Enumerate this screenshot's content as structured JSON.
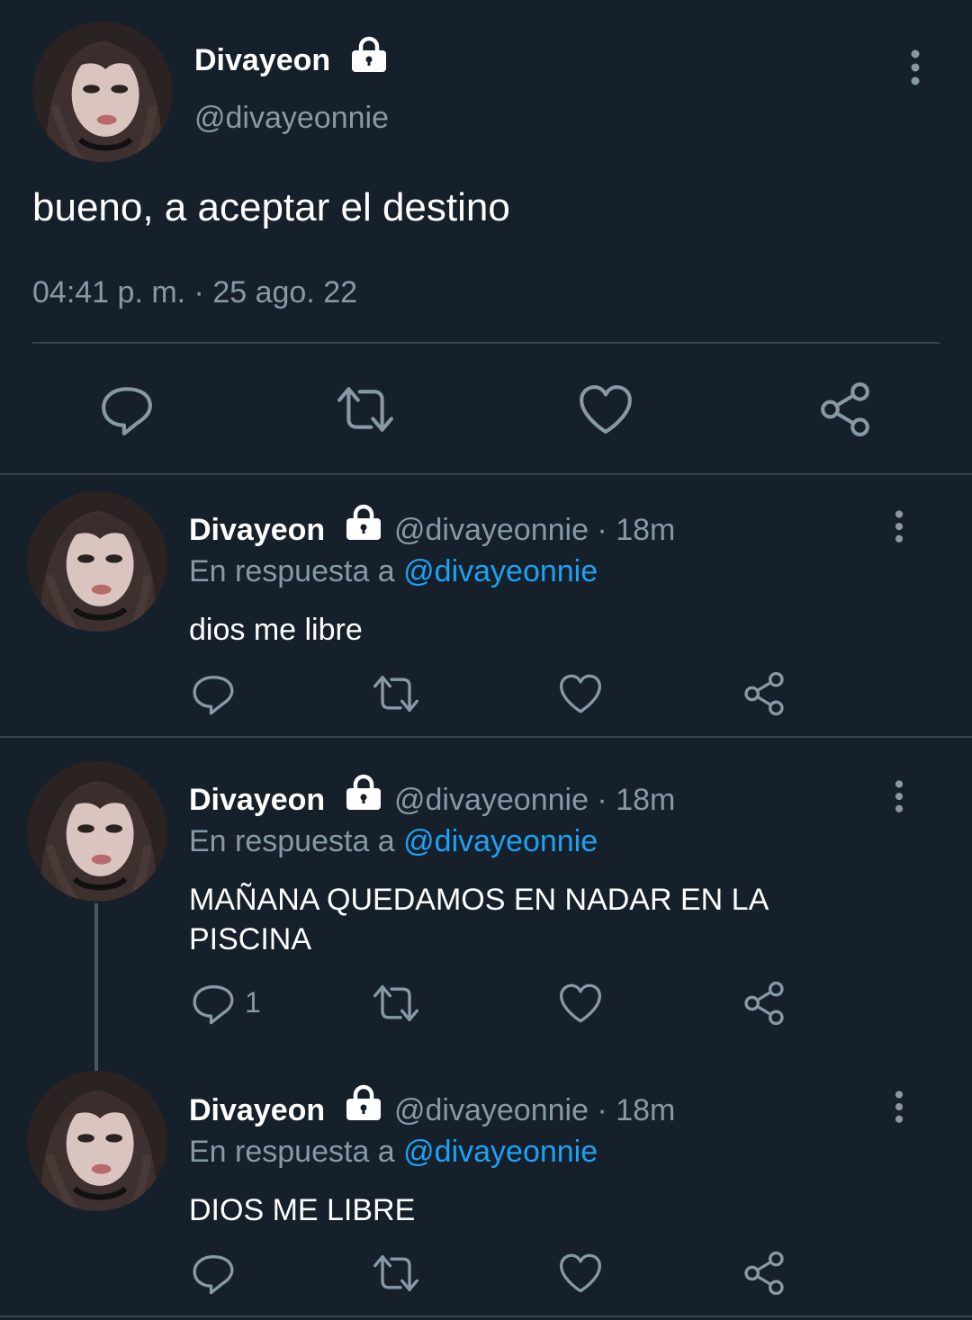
{
  "main_tweet": {
    "name": "Divayeon",
    "handle": "@divayeonnie",
    "text": "bueno, a aceptar el destino",
    "timestamp": "04:41 p. m. · 25 ago. 22",
    "icons": [
      "lock-icon",
      "more-vertical-icon",
      "reply-icon",
      "retweet-icon",
      "like-icon",
      "share-icon"
    ]
  },
  "replies": [
    {
      "name": "Divayeon",
      "handle_time": "@divayeonnie · 18m",
      "reply_prefix": "En respuesta a ",
      "reply_to": "@divayeonnie",
      "text": "dios me libre",
      "reply_count": ""
    },
    {
      "name": "Divayeon",
      "handle_time": "@divayeonnie · 18m",
      "reply_prefix": "En respuesta a ",
      "reply_to": "@divayeonnie",
      "text": "MAÑANA QUEDAMOS EN NADAR EN LA PISCINA",
      "reply_count": "1"
    },
    {
      "name": "Divayeon",
      "handle_time": "@divayeonnie · 18m",
      "reply_prefix": "En respuesta a ",
      "reply_to": "@divayeonnie",
      "text": "DIOS ME LIBRE",
      "reply_count": ""
    }
  ],
  "colors": {
    "background": "#15202b",
    "secondary_text": "#8899a6",
    "mention": "#1da1f2",
    "divider": "#38444d"
  }
}
